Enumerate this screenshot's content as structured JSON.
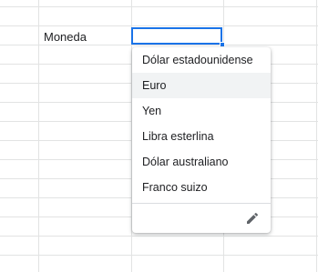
{
  "sheet": {
    "label_cell": "Moneda",
    "active_cell_value": ""
  },
  "dropdown": {
    "options": [
      {
        "label": "Dólar estadounidense"
      },
      {
        "label": "Euro"
      },
      {
        "label": "Yen"
      },
      {
        "label": "Libra esterlina"
      },
      {
        "label": "Dólar australiano"
      },
      {
        "label": "Franco suizo"
      }
    ],
    "hovered_option": "Euro",
    "edit_icon": "pencil-icon"
  },
  "colors": {
    "selection": "#1a73e8",
    "gridline": "#e2e3e3",
    "hover": "#f1f3f4",
    "text": "#202124"
  }
}
